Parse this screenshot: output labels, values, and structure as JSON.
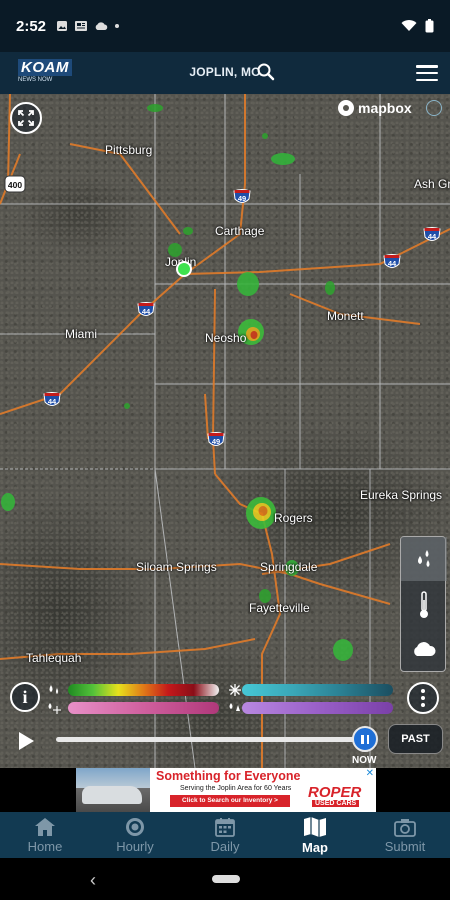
{
  "status_bar": {
    "time": "2:52",
    "icons": [
      "image-icon",
      "news-icon",
      "cloud-icon",
      "dot-icon"
    ],
    "right_icons": [
      "wifi-icon",
      "battery-icon"
    ]
  },
  "header": {
    "logo_text": "KOAM",
    "logo_sub": "NEWS NOW",
    "location": "JOPLIN, MO",
    "search_icon": "search-icon",
    "menu_icon": "hamburger-menu-icon"
  },
  "map": {
    "attribution": "mapbox",
    "cities": {
      "pittsburg": "Pittsburg",
      "ash_grove": "Ash Gr",
      "carthage": "Carthage",
      "joplin": "Joplin",
      "miami": "Miami",
      "neosho": "Neosho",
      "monett": "Monett",
      "eureka_springs": "Eureka Springs",
      "rogers": "Rogers",
      "siloam_springs": "Siloam Springs",
      "springdale": "Springdale",
      "fayetteville": "Fayetteville",
      "tahlequah": "Tahlequah"
    },
    "shields": {
      "s400": "400",
      "s49a": "49",
      "s44a": "44",
      "s44b": "44",
      "s44c": "44",
      "s44d": "44",
      "s49b": "49"
    }
  },
  "layers": {
    "items": [
      "precipitation-icon",
      "thermometer-icon",
      "cloud-icon"
    ],
    "active_index": 0
  },
  "legend": {
    "info_label": "i",
    "rows": [
      {
        "icon": "rain-icon",
        "colors": [
          "#1f8a22",
          "#54c23a",
          "#e7e11c",
          "#e07a18",
          "#c4181a",
          "#8a0e18",
          "#f2f2f2"
        ]
      },
      {
        "icon": "snow-icon",
        "colors": [
          "#46c8d6",
          "#3aa8b8",
          "#2a7f92",
          "#1b4e60"
        ]
      },
      {
        "icon": "mix-icon",
        "colors": [
          "#e890c8",
          "#d0609e",
          "#b0387a"
        ]
      },
      {
        "icon": "ice-icon",
        "colors": [
          "#b888e0",
          "#9a60c8",
          "#7a40a8"
        ]
      }
    ]
  },
  "playback": {
    "now_label": "NOW",
    "past_label": "PAST",
    "progress": 1.0
  },
  "ad": {
    "title": "Something for Everyone",
    "subtitle": "Serving the Joplin Area for 60 Years",
    "cta": "Click to Search our Inventory >",
    "brand": "ROPER",
    "brand_sub": "USED CARS",
    "close": "✕"
  },
  "bottom_nav": {
    "items": [
      {
        "label": "Home",
        "icon": "home-icon"
      },
      {
        "label": "Hourly",
        "icon": "clock-icon"
      },
      {
        "label": "Daily",
        "icon": "calendar-icon"
      },
      {
        "label": "Map",
        "icon": "map-icon"
      },
      {
        "label": "Submit",
        "icon": "camera-icon"
      }
    ],
    "active_index": 3
  },
  "colors": {
    "header_bg": "#102a3d",
    "nav_bg": "#123a52",
    "accent": "#1f6fd6",
    "location_dot": "#3ee24e"
  }
}
